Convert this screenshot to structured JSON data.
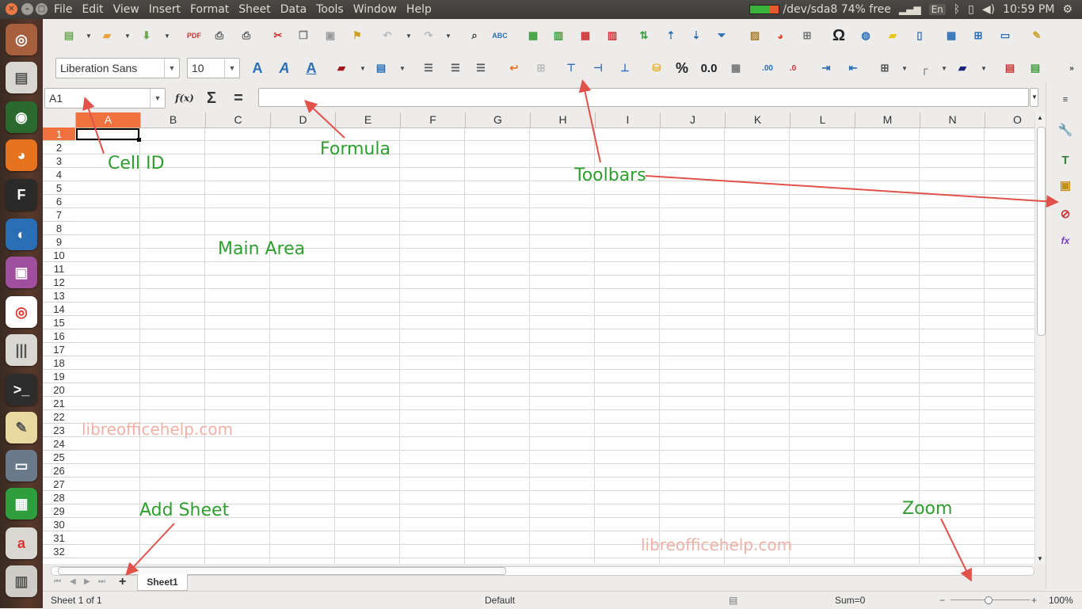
{
  "menubar": {
    "items": [
      "File",
      "Edit",
      "View",
      "Insert",
      "Format",
      "Sheet",
      "Data",
      "Tools",
      "Window",
      "Help"
    ],
    "disk_indicator": "/dev/sda8 74% free",
    "keyboard_layout": "En",
    "clock": "10:59 PM"
  },
  "toolbar": {
    "font_name": "Liberation Sans",
    "font_size": "10",
    "percent_label": "%",
    "decimal_label": "0.0"
  },
  "formula_bar": {
    "cell_ref": "A1",
    "function_wizard_label": "f(x)",
    "sum_label": "Σ",
    "equals_label": "=",
    "content": ""
  },
  "grid": {
    "columns": [
      "A",
      "B",
      "C",
      "D",
      "E",
      "F",
      "G",
      "H",
      "I",
      "J",
      "K",
      "L",
      "M",
      "N",
      "O"
    ],
    "rows": [
      "1",
      "2",
      "3",
      "4",
      "5",
      "6",
      "7",
      "8",
      "9",
      "10",
      "11",
      "12",
      "13",
      "14",
      "15",
      "16",
      "17",
      "18",
      "19",
      "20",
      "21",
      "22",
      "23",
      "24",
      "25",
      "26",
      "27",
      "28",
      "29",
      "30",
      "31",
      "32"
    ],
    "selected_column": "A",
    "selected_row": "1"
  },
  "tabs": {
    "sheets": [
      "Sheet1"
    ],
    "add_sheet_label": "+"
  },
  "statusbar": {
    "sheet_info": "Sheet 1 of 1",
    "page_style": "Default",
    "sum": "Sum=0",
    "zoom": "100%"
  },
  "annotations": {
    "cell_id": "Cell ID",
    "formula": "Formula",
    "toolbars": "Toolbars",
    "main_area": "Main Area",
    "add_sheet": "Add Sheet",
    "zoom": "Zoom"
  },
  "watermark": "libreofficehelp.com",
  "colors": {
    "accent": "#f0733f",
    "annotation": "#2e9e2e",
    "arrow": "#e0524a",
    "watermark": "#f0b0a6"
  }
}
